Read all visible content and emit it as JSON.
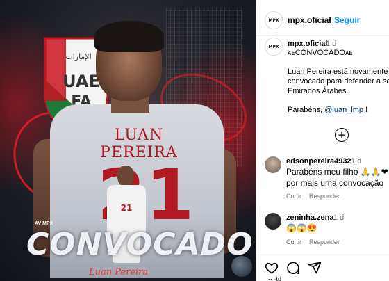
{
  "post_image": {
    "logo_text_top": "الإمارات",
    "logo_text_main": "UAE",
    "logo_text_sub": "FA",
    "jersey_name": "LUAN PEREIRA",
    "jersey_number": "21",
    "mini_number": "21",
    "headline": "CONVOCADO",
    "script_name": "Luan Pereira",
    "sponsors": "AV  MPX",
    "colors": {
      "accent_red": "#c8141e",
      "jersey": "#d8dbe0"
    }
  },
  "header": {
    "username": "mpx.oficial",
    "separator": "•",
    "follow_label": "Seguir",
    "avatar_text": "MPX"
  },
  "caption": {
    "username": "mpx.oficial",
    "time": "1 d",
    "line1": "ᴀᴇCONVOCADOᴀᴇ",
    "line2": "Luan Pereira está novamente",
    "line3": "convocado para defender a sele",
    "line4": "Emirados Árabes.",
    "line5_prefix": "Parabéns,",
    "line5_mention": "@luan_lmp",
    "line5_suffix": "!"
  },
  "load_more_icon": "plus-circle-icon",
  "comments": [
    {
      "username": "edsonpereira4932",
      "time": "1 d",
      "text_line1": "Parabéns meu filho 🙏🙏❤",
      "text_line2": "por mais uma convocação",
      "reply_label": "Curtir",
      "respond_label": "Responder"
    },
    {
      "username": "zeninha.zena",
      "time": "1 d",
      "text_line1": "😱😱😍",
      "reply_label": "Curtir",
      "respond_label": "Responder"
    }
  ],
  "actions": {
    "like_icon": "heart-icon",
    "comment_icon": "comment-icon",
    "share_icon": "share-icon",
    "bottom_partial_text": "··· ·td"
  }
}
